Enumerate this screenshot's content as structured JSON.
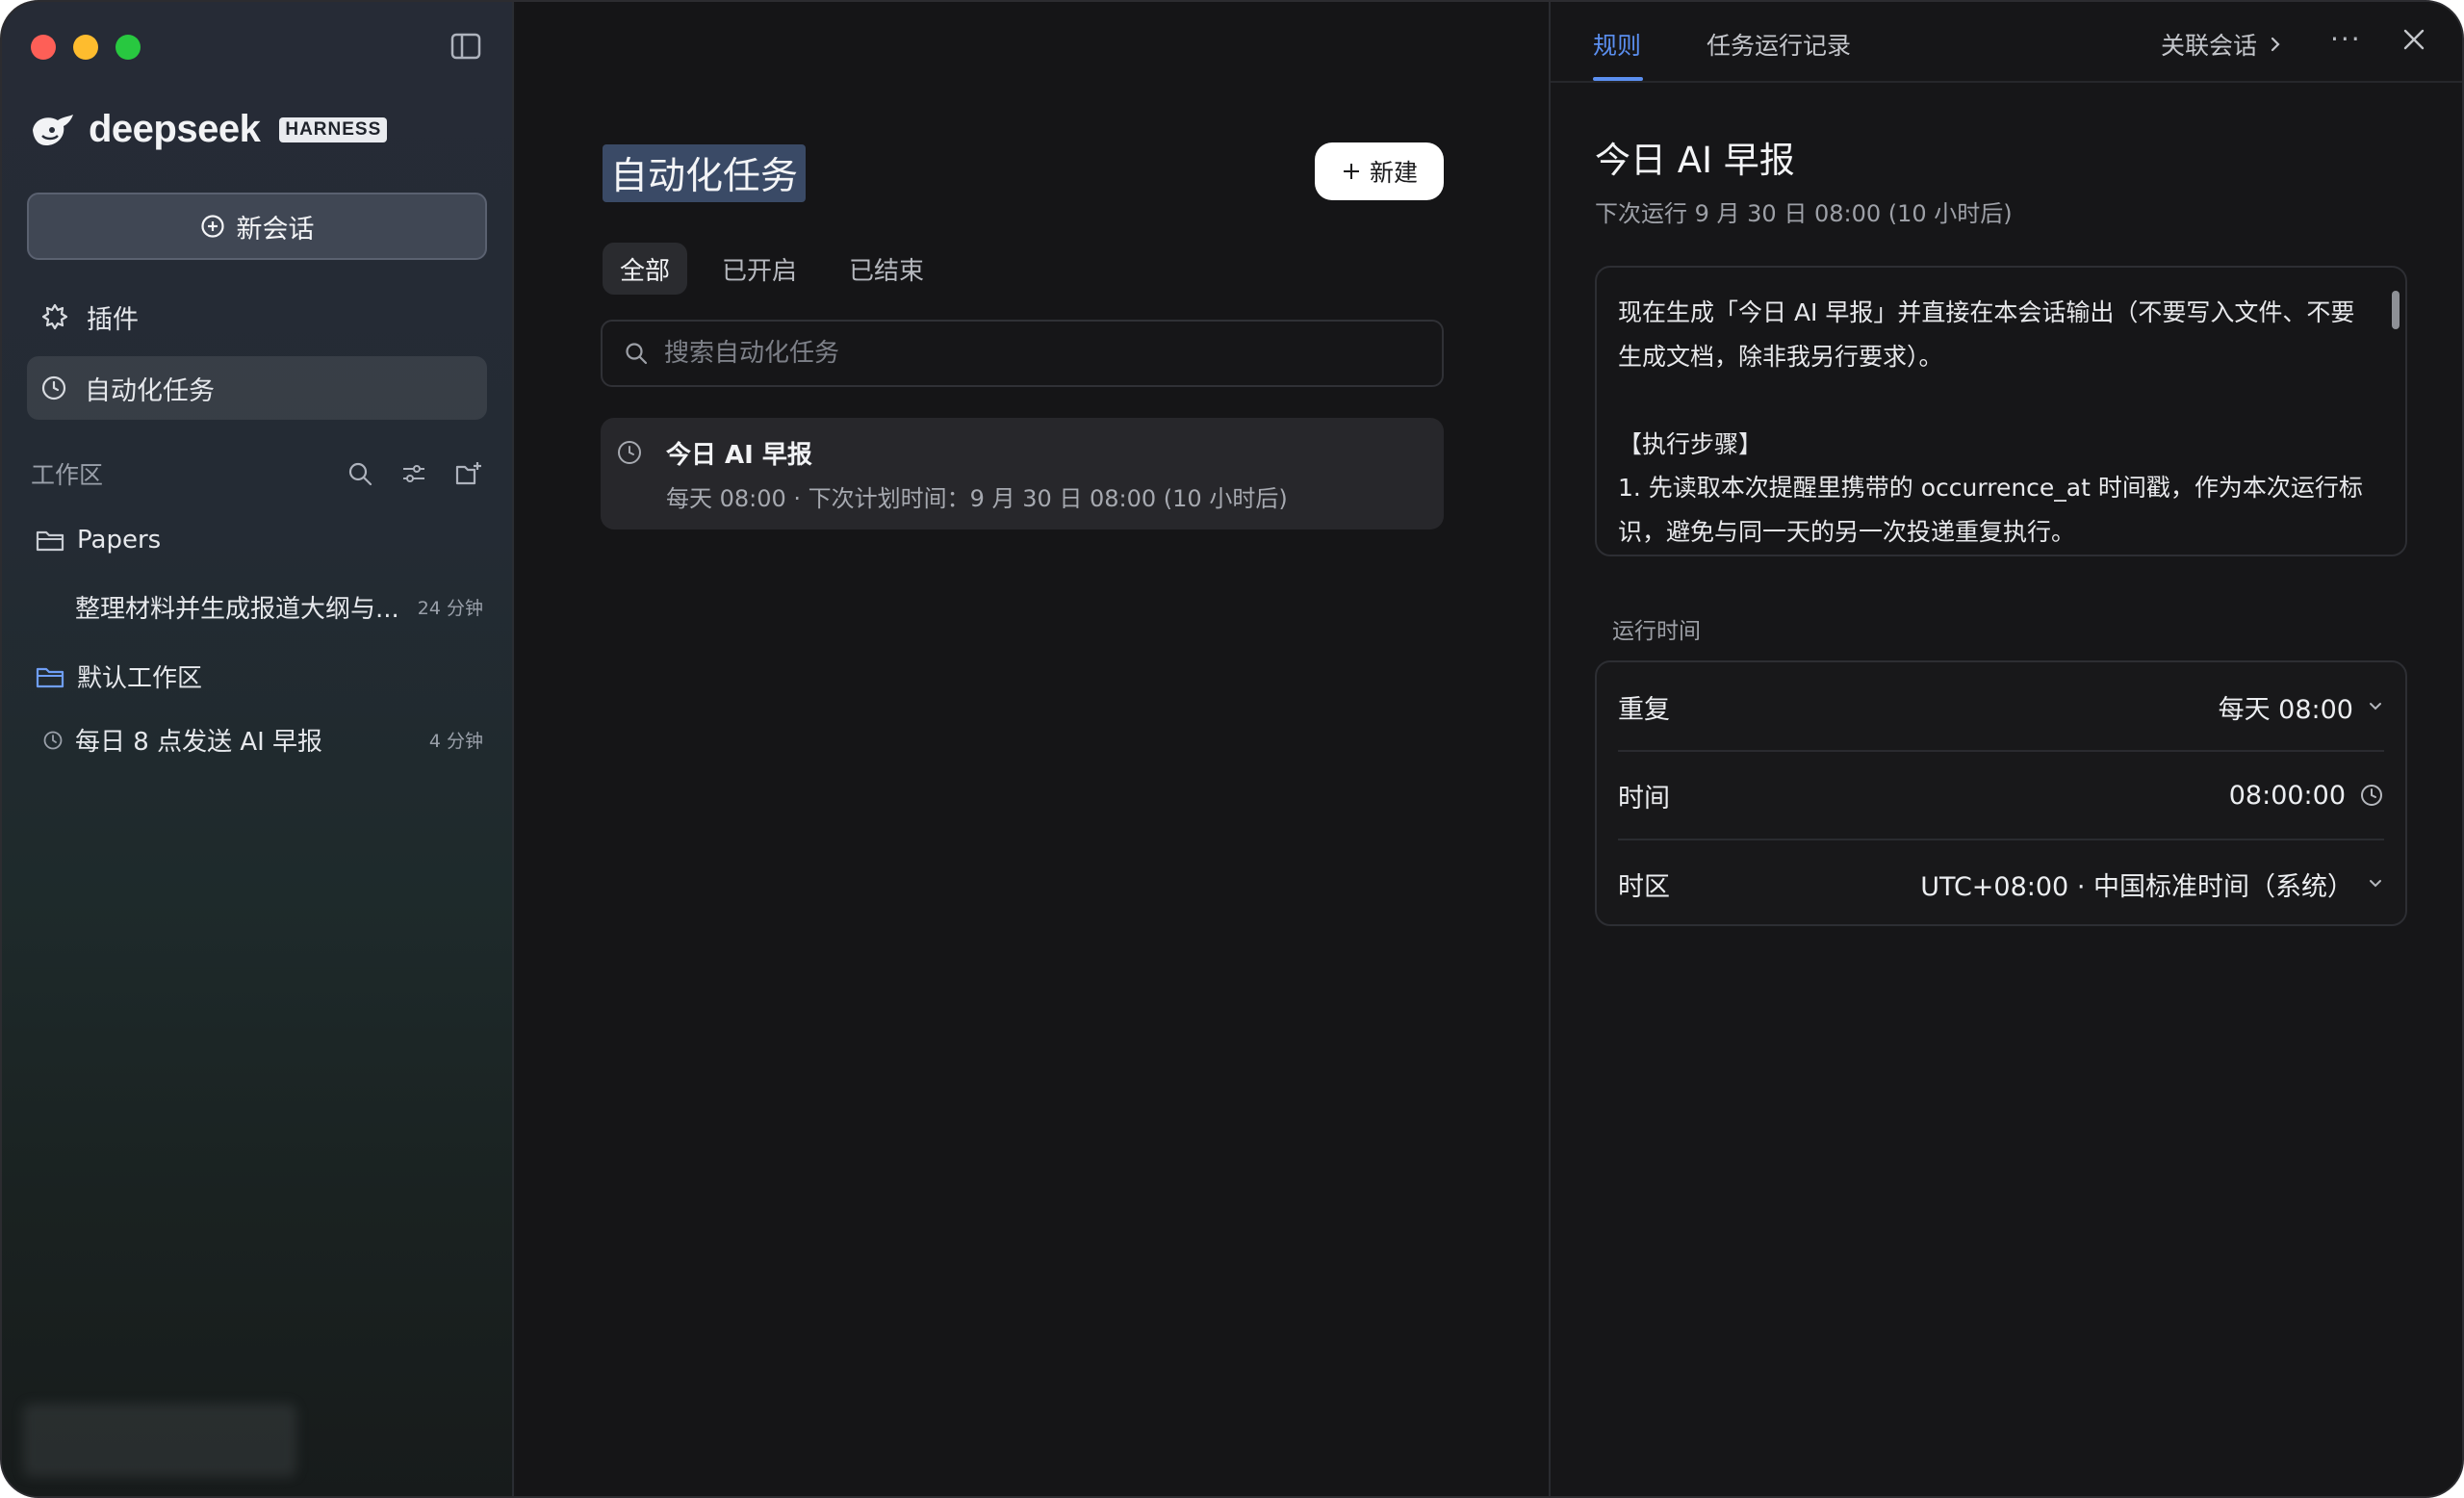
{
  "sidebar": {
    "brand": {
      "name": "deepseek",
      "badge": "HARNESS"
    },
    "new_chat_label": "新会话",
    "nav": [
      {
        "label": "插件"
      },
      {
        "label": "自动化任务"
      }
    ],
    "workspace_title": "工作区",
    "folders": [
      {
        "name": "Papers"
      },
      {
        "name": "默认工作区"
      }
    ],
    "items": [
      {
        "title": "整理材料并生成报道大纲与...",
        "time": "24 分钟"
      },
      {
        "title": "每日 8 点发送 AI 早报",
        "time": "4 分钟"
      }
    ]
  },
  "main": {
    "title": "自动化任务",
    "new_button_label": "新建",
    "filters": [
      "全部",
      "已开启",
      "已结束"
    ],
    "search_placeholder": "搜索自动化任务",
    "tasks": [
      {
        "name": "今日 AI 早报",
        "meta": "每天 08:00 · 下次计划时间：9 月 30 日 08:00 (10 小时后)"
      }
    ]
  },
  "panel": {
    "tabs": [
      "规则",
      "任务运行记录"
    ],
    "related_label": "关联会话",
    "title": "今日 AI 早报",
    "next_run": "下次运行 9 月 30 日 08:00 (10 小时后)",
    "prompt": "现在生成「今日 AI 早报」并直接在本会话输出（不要写入文件、不要生成文档，除非我另行要求）。\n\n【执行步骤】\n1. 先读取本次提醒里携带的 occurrence_at 时间戳，作为本次运行标识，避免与同一天的另一次投递重复执行。",
    "schedule_label": "运行时间",
    "schedule": {
      "repeat": {
        "label": "重复",
        "value": "每天 08:00"
      },
      "time": {
        "label": "时间",
        "value": "08:00:00"
      },
      "timezone": {
        "label": "时区",
        "value": "UTC+08:00 · 中国标准时间（系统）"
      }
    }
  },
  "colors": {
    "accent": "#5b8ff0",
    "traffic_red": "#fe5f57",
    "traffic_yellow": "#febc2e",
    "traffic_green": "#28c840"
  }
}
